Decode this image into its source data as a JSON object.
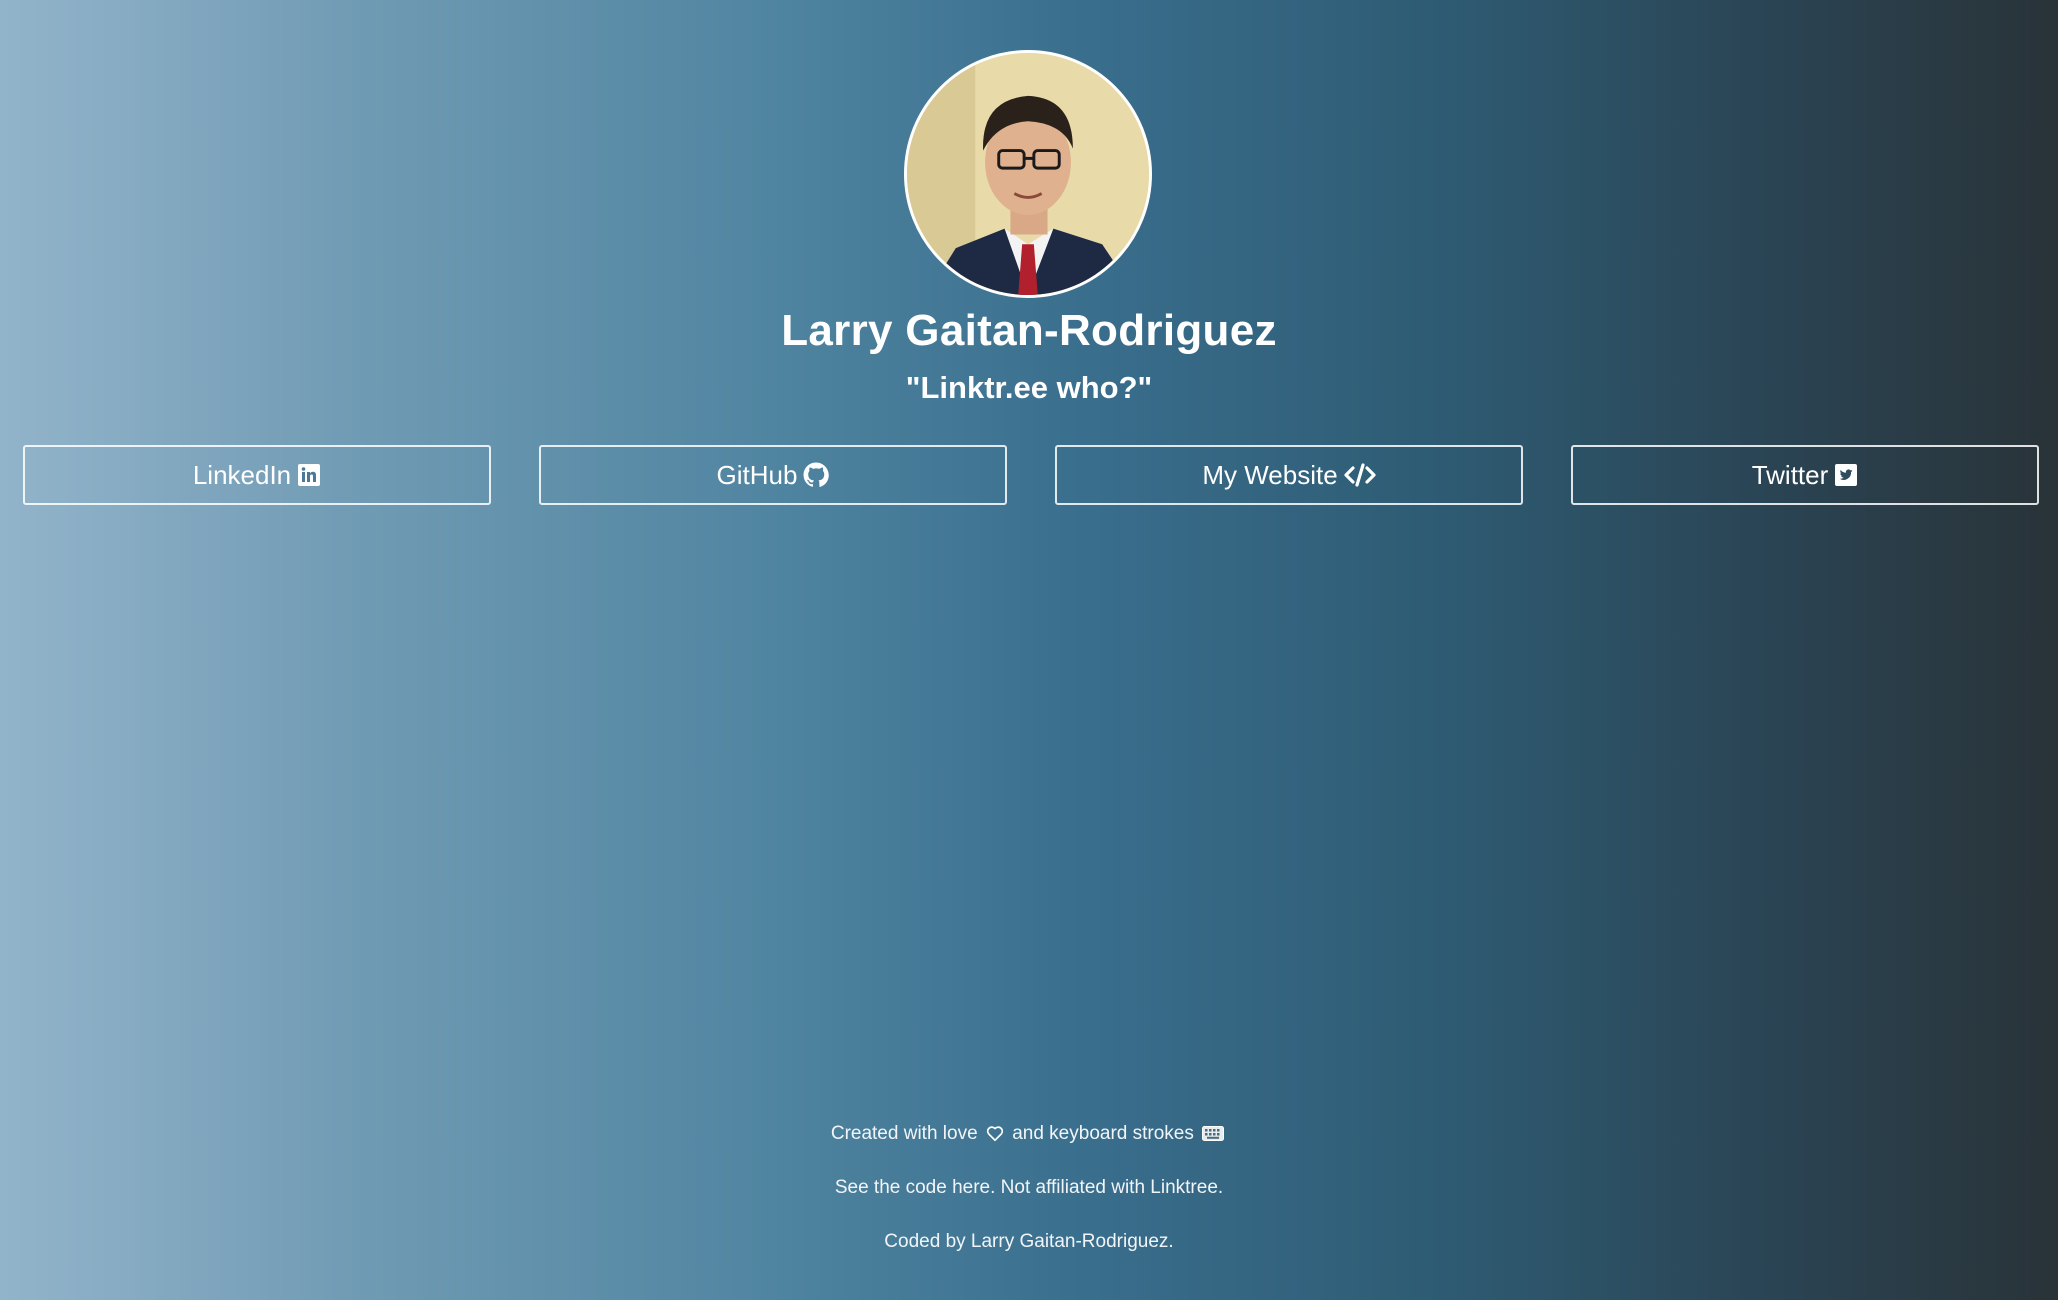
{
  "profile": {
    "name": "Larry Gaitan-Rodriguez",
    "tagline": "\"Linktr.ee who?\"",
    "avatar_icon": "profile-photo"
  },
  "links": [
    {
      "label": "LinkedIn",
      "icon": "linkedin-icon"
    },
    {
      "label": "GitHub",
      "icon": "github-icon"
    },
    {
      "label": "My Website",
      "icon": "code-icon"
    },
    {
      "label": "Twitter",
      "icon": "twitter-icon"
    }
  ],
  "footer": {
    "line1_a": "Created with love",
    "line1_b": "and keyboard strokes",
    "line2_prefix": "See the code",
    "line2_link": "here",
    "line2_suffix": ". Not affiliated with Linktree.",
    "line3_prefix": "Coded by",
    "line3_link": "Larry Gaitan-Rodriguez",
    "line3_suffix": "."
  },
  "colors": {
    "text": "#ffffff",
    "gradient_start": "#92b4ca",
    "gradient_mid": "#3a6f8e",
    "gradient_end": "#293338"
  }
}
